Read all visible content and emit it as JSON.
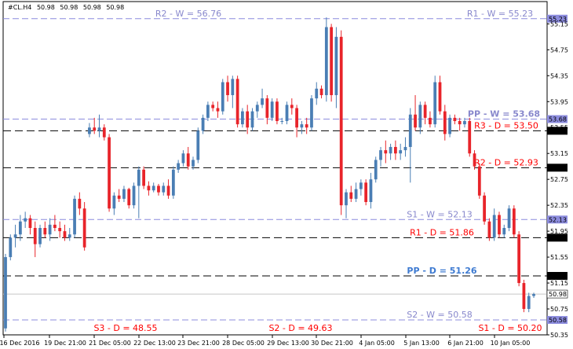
{
  "chart_data": {
    "type": "candlestick",
    "header": {
      "symbol": "#CL.H4",
      "ohlc": [
        "50.98",
        "50.98",
        "50.98",
        "50.98"
      ]
    },
    "ylim": [
      50.35,
      55.3
    ],
    "y_ticks": [
      "55.15",
      "54.75",
      "54.35",
      "53.95",
      "53.55",
      "53.15",
      "52.75",
      "52.35",
      "51.95",
      "51.55",
      "51.15",
      "50.75",
      "50.35"
    ],
    "x_ticks": [
      "16 Dec 2016",
      "19 Dec 21:00",
      "21 Dec 05:00",
      "22 Dec 13:00",
      "23 Dec 21:00",
      "28 Dec 05:00",
      "29 Dec 13:00",
      "30 Dec 21:00",
      "4 Jan 05:00",
      "5 Jan 13:00",
      "6 Jan 21:00",
      "10 Jan 05:00"
    ],
    "price_tag": {
      "value": "50.98",
      "price": 50.98
    },
    "levels": [
      {
        "price": 55.23,
        "tag": "55.23",
        "style": "weekly",
        "labels": [
          {
            "text": "R2 - W = 56.76",
            "pos": "left"
          },
          {
            "text": "R1 - W = 55.23",
            "pos": "right"
          }
        ]
      },
      {
        "price": 53.68,
        "tag": "53.68",
        "style": "weekly",
        "labels": [
          {
            "text": "PP - W = 53.68",
            "pos": "right",
            "bold": true
          }
        ]
      },
      {
        "price": 53.5,
        "tag": "53.50",
        "style": "daily",
        "labels": [
          {
            "text": "R3 - D = 53.50",
            "pos": "right",
            "color": "#ff0000"
          }
        ]
      },
      {
        "price": 52.93,
        "tag": "52.93",
        "style": "daily",
        "labels": [
          {
            "text": "R2 - D = 52.93",
            "pos": "right",
            "color": "#ff0000"
          }
        ]
      },
      {
        "price": 52.13,
        "tag": "52.13",
        "style": "weekly",
        "labels": [
          {
            "text": "S1 - W = 52.13",
            "pos": "right"
          }
        ]
      },
      {
        "price": 51.85,
        "tag": "51.85",
        "style": "daily",
        "labels": [
          {
            "text": "R1 - D = 51.86",
            "pos": "right",
            "color": "#ff0000"
          }
        ]
      },
      {
        "price": 51.26,
        "tag": "51.26",
        "style": "daily",
        "labels": [
          {
            "text": "PP - D = 51.26",
            "pos": "right",
            "color": "#3d7ad1",
            "bold": true
          }
        ]
      },
      {
        "price": 50.58,
        "tag": "50.58",
        "style": "weekly",
        "labels": [
          {
            "text": "S2 - W = 50.58",
            "pos": "right"
          }
        ]
      }
    ],
    "bottom_labels": [
      "S3 - D = 48.55",
      "S2 - D = 49.63",
      "S1 - D = 50.20"
    ],
    "colors": {
      "bull": "#4a7eb4",
      "bear": "#e8242a",
      "weekly": "#8c8cde",
      "daily": "#000000",
      "label_blue": "#8888cc",
      "tag_bg": "#ffffff"
    },
    "candles": [
      [
        50.45,
        51.6,
        50.4,
        51.55
      ],
      [
        51.55,
        51.9,
        51.5,
        51.85
      ],
      [
        51.85,
        52.05,
        51.7,
        51.9
      ],
      [
        51.9,
        52.2,
        51.8,
        52.1
      ],
      [
        52.1,
        52.25,
        52.0,
        52.15
      ],
      [
        52.15,
        52.2,
        51.9,
        52.0
      ],
      [
        52.0,
        52.1,
        51.55,
        51.75
      ],
      [
        51.75,
        52.05,
        51.7,
        52.0
      ],
      [
        52.0,
        52.1,
        51.85,
        51.9
      ],
      [
        51.9,
        52.15,
        51.8,
        52.05
      ],
      [
        52.05,
        52.2,
        51.95,
        52.0
      ],
      [
        52.0,
        52.1,
        51.85,
        51.95
      ],
      [
        51.95,
        52.05,
        51.8,
        51.85
      ],
      [
        51.85,
        52.0,
        51.8,
        51.9
      ],
      [
        51.9,
        52.5,
        51.85,
        52.45
      ],
      [
        52.45,
        52.55,
        52.2,
        52.3
      ],
      [
        52.3,
        52.4,
        51.65,
        51.7
      ],
      [
        53.45,
        53.62,
        53.4,
        53.55
      ],
      [
        53.55,
        53.7,
        53.45,
        53.5
      ],
      [
        53.5,
        53.75,
        53.4,
        53.55
      ],
      [
        53.55,
        53.6,
        53.35,
        53.4
      ],
      [
        53.4,
        53.45,
        52.25,
        52.3
      ],
      [
        52.3,
        52.55,
        52.2,
        52.5
      ],
      [
        52.5,
        52.6,
        52.4,
        52.45
      ],
      [
        52.45,
        52.65,
        52.4,
        52.6
      ],
      [
        52.6,
        52.62,
        52.3,
        52.35
      ],
      [
        52.35,
        52.7,
        52.3,
        52.65
      ],
      [
        52.65,
        52.95,
        52.15,
        52.9
      ],
      [
        52.9,
        52.95,
        52.6,
        52.65
      ],
      [
        52.65,
        52.72,
        52.5,
        52.58
      ],
      [
        52.58,
        52.7,
        52.55,
        52.65
      ],
      [
        52.65,
        52.68,
        52.5,
        52.55
      ],
      [
        52.55,
        52.7,
        52.5,
        52.65
      ],
      [
        52.65,
        52.75,
        52.45,
        52.5
      ],
      [
        52.5,
        52.95,
        52.45,
        52.9
      ],
      [
        52.9,
        53.05,
        52.85,
        53.0
      ],
      [
        53.0,
        53.2,
        52.95,
        53.15
      ],
      [
        53.15,
        53.25,
        52.9,
        52.95
      ],
      [
        52.95,
        53.1,
        52.9,
        53.05
      ],
      [
        53.05,
        53.55,
        53.0,
        53.5
      ],
      [
        53.5,
        53.75,
        53.45,
        53.7
      ],
      [
        53.7,
        53.95,
        53.65,
        53.9
      ],
      [
        53.9,
        53.95,
        53.8,
        53.85
      ],
      [
        53.85,
        53.95,
        53.7,
        53.8
      ],
      [
        53.8,
        54.3,
        53.75,
        54.25
      ],
      [
        54.25,
        54.35,
        53.95,
        54.05
      ],
      [
        54.05,
        54.35,
        53.85,
        54.3
      ],
      [
        54.3,
        54.35,
        53.55,
        53.6
      ],
      [
        53.6,
        53.85,
        53.55,
        53.8
      ],
      [
        53.8,
        53.9,
        53.45,
        53.55
      ],
      [
        53.55,
        53.85,
        53.5,
        53.8
      ],
      [
        53.8,
        53.95,
        53.7,
        53.9
      ],
      [
        53.9,
        54.15,
        53.85,
        54.0
      ],
      [
        54.0,
        54.05,
        53.6,
        53.7
      ],
      [
        53.7,
        54.0,
        53.65,
        53.95
      ],
      [
        53.95,
        54.0,
        53.6,
        53.65
      ],
      [
        53.65,
        53.7,
        53.6,
        53.65
      ],
      [
        53.65,
        53.95,
        53.6,
        53.9
      ],
      [
        53.9,
        54.0,
        53.75,
        53.85
      ],
      [
        53.85,
        53.9,
        53.4,
        53.55
      ],
      [
        53.55,
        53.65,
        53.45,
        53.6
      ],
      [
        53.6,
        53.7,
        53.45,
        53.55
      ],
      [
        53.55,
        54.05,
        53.5,
        54.0
      ],
      [
        54.0,
        54.25,
        53.9,
        54.15
      ],
      [
        54.15,
        54.2,
        54.0,
        54.05
      ],
      [
        54.05,
        55.25,
        53.95,
        55.1
      ],
      [
        55.1,
        55.15,
        53.95,
        54.05
      ],
      [
        54.05,
        55.1,
        53.85,
        54.95
      ],
      [
        54.95,
        55.05,
        52.2,
        52.35
      ],
      [
        52.35,
        52.6,
        52.15,
        52.55
      ],
      [
        52.55,
        52.65,
        52.4,
        52.45
      ],
      [
        52.45,
        52.7,
        52.4,
        52.6
      ],
      [
        52.6,
        52.75,
        52.5,
        52.7
      ],
      [
        52.7,
        52.75,
        52.35,
        52.4
      ],
      [
        52.4,
        52.85,
        52.3,
        52.75
      ],
      [
        52.75,
        53.1,
        52.7,
        53.05
      ],
      [
        53.05,
        53.25,
        52.95,
        53.2
      ],
      [
        53.2,
        53.35,
        53.0,
        53.15
      ],
      [
        53.15,
        53.3,
        53.05,
        53.25
      ],
      [
        53.25,
        53.35,
        53.05,
        53.15
      ],
      [
        53.15,
        53.3,
        53.05,
        53.2
      ],
      [
        53.2,
        53.4,
        53.1,
        53.25
      ],
      [
        53.25,
        53.85,
        52.7,
        53.75
      ],
      [
        53.75,
        54.05,
        53.5,
        53.55
      ],
      [
        53.55,
        53.95,
        53.45,
        53.9
      ],
      [
        53.9,
        53.95,
        53.6,
        53.7
      ],
      [
        53.7,
        53.8,
        53.55,
        53.6
      ],
      [
        53.6,
        54.35,
        53.55,
        54.25
      ],
      [
        54.25,
        54.35,
        53.75,
        53.8
      ],
      [
        53.8,
        53.9,
        53.35,
        53.45
      ],
      [
        53.45,
        53.75,
        53.4,
        53.7
      ],
      [
        53.7,
        53.75,
        53.6,
        53.65
      ],
      [
        53.65,
        53.7,
        53.5,
        53.6
      ],
      [
        53.6,
        53.7,
        53.55,
        53.65
      ],
      [
        53.65,
        53.7,
        53.1,
        53.15
      ],
      [
        53.15,
        53.2,
        52.9,
        52.95
      ],
      [
        52.95,
        53.0,
        52.45,
        52.5
      ],
      [
        52.5,
        52.55,
        52.05,
        52.1
      ],
      [
        52.1,
        52.15,
        51.8,
        51.85
      ],
      [
        51.85,
        52.3,
        51.8,
        52.2
      ],
      [
        52.2,
        52.25,
        51.85,
        51.9
      ],
      [
        51.9,
        52.05,
        51.85,
        52.0
      ],
      [
        52.0,
        52.35,
        51.95,
        52.3
      ],
      [
        52.3,
        52.35,
        51.85,
        51.9
      ],
      [
        51.9,
        51.95,
        51.1,
        51.15
      ],
      [
        51.15,
        51.2,
        50.7,
        50.75
      ],
      [
        50.75,
        51.0,
        50.7,
        50.95
      ],
      [
        50.95,
        51.0,
        50.92,
        50.98
      ]
    ]
  }
}
